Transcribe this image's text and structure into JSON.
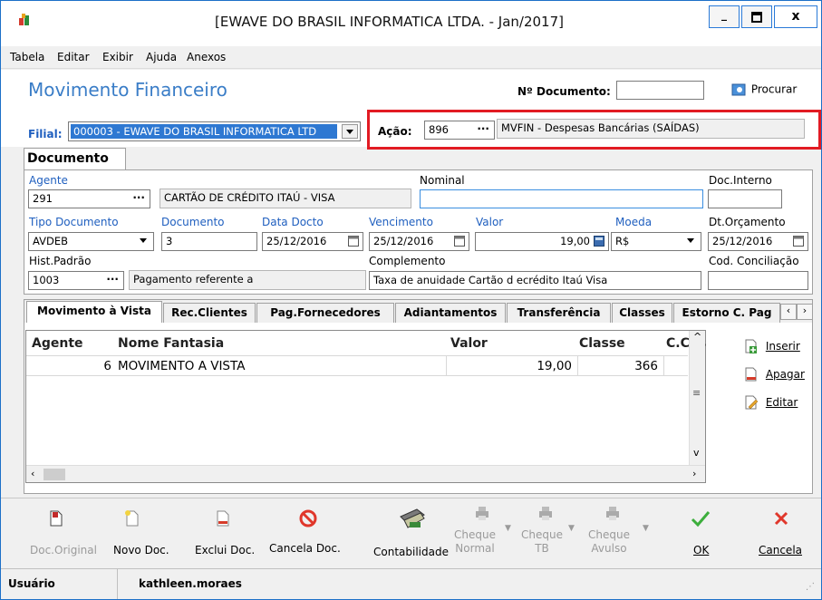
{
  "window": {
    "title": "[EWAVE DO BRASIL INFORMATICA LTDA. - Jan/2017]",
    "minimize": "_",
    "maximize": "□",
    "close": "x"
  },
  "menu": [
    "Tabela",
    "Editar",
    "Exibir",
    "Ajuda",
    "Anexos"
  ],
  "header": {
    "page_title": "Movimento Financeiro",
    "doc_number_label": "Nº Documento:",
    "doc_number_value": "",
    "search_label": "Procurar",
    "filial_label": "Filial:",
    "filial_value": "000003 - EWAVE DO BRASIL INFORMATICA LTD",
    "acao_label": "Ação:",
    "acao_code": "896",
    "acao_desc": "MVFIN - Despesas Bancárias (SAÍDAS)",
    "dots": "···"
  },
  "document_tab": "Documento",
  "form": {
    "agente_label": "Agente",
    "agente_code": "291",
    "agente_name": "CARTÃO DE CRÉDITO ITAÚ - VISA",
    "nominal_label": "Nominal",
    "nominal_value": "",
    "doc_interno_label": "Doc.Interno",
    "doc_interno_value": "",
    "tipo_doc_label": "Tipo Documento",
    "tipo_doc_value": "AVDEB",
    "documento_label": "Documento",
    "documento_value": "3",
    "data_docto_label": "Data Docto",
    "data_docto_value": "25/12/2016",
    "vencimento_label": "Vencimento",
    "vencimento_value": "25/12/2016",
    "valor_label": "Valor",
    "valor_value": "19,00",
    "moeda_label": "Moeda",
    "moeda_value": "R$",
    "dt_orcamento_label": "Dt.Orçamento",
    "dt_orcamento_value": "25/12/2016",
    "hist_label": "Hist.Padrão",
    "hist_code": "1003",
    "hist_desc": "Pagamento referente a",
    "complemento_label": "Complemento",
    "complemento_value": "Taxa de anuidade Cartão d ecrédito Itaú Visa",
    "cod_conc_label": "Cod. Conciliação",
    "cod_conc_value": ""
  },
  "tabs": [
    {
      "label": "Movimento à Vista"
    },
    {
      "label": "Rec.Clientes"
    },
    {
      "label": "Pag.Fornecedores"
    },
    {
      "label": "Adiantamentos"
    },
    {
      "label": "Transferência"
    },
    {
      "label": "Classes"
    },
    {
      "label": "Estorno C. Pag"
    }
  ],
  "grid": {
    "headers": [
      "Agente",
      "Nome Fantasia",
      "Valor",
      "Classe",
      "C.Cus"
    ],
    "rows": [
      {
        "agente": "6",
        "nome": "MOVIMENTO A VISTA",
        "valor": "19,00",
        "classe": "366",
        "ccusto": ""
      }
    ]
  },
  "side_buttons": [
    "Inserir",
    "Apagar",
    "Editar"
  ],
  "toolbar": {
    "doc_original": "Doc.Original",
    "novo_doc": "Novo Doc.",
    "exclui_doc": "Exclui Doc.",
    "cancela_doc": "Cancela Doc.",
    "contabilidade": "Contabilidade",
    "cheque_normal": "Cheque\nNormal",
    "cheque_tb": "Cheque\nTB",
    "cheque_avulso": "Cheque\nAvulso",
    "ok": "OK",
    "cancela": "Cancela"
  },
  "status": {
    "user_label": "Usuário",
    "user_value": "kathleen.moraes"
  }
}
